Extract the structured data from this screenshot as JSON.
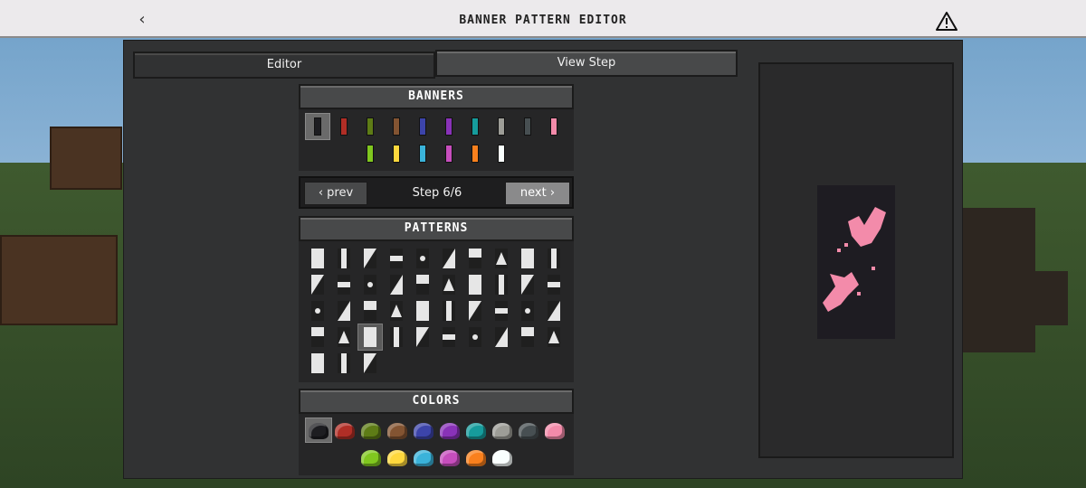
{
  "header": {
    "title": "BANNER PATTERN EDITOR",
    "back_glyph": "‹",
    "warning_icon": "warning-triangle-icon"
  },
  "tabs": [
    {
      "label": "Editor",
      "active": false
    },
    {
      "label": "View Step",
      "active": true
    }
  ],
  "sections": {
    "banners": "BANNERS",
    "patterns": "PATTERNS",
    "colors": "COLORS"
  },
  "stepper": {
    "prev_label": "‹ prev",
    "step_label": "Step 6/6",
    "next_label": "next ›"
  },
  "banner_colors": [
    "#1d1d21",
    "#b02e26",
    "#5e7c16",
    "#835432",
    "#3c44aa",
    "#8932b8",
    "#169c9c",
    "#9d9d97",
    "#474f52",
    "#f38baa",
    "#80c71f",
    "#fed83d",
    "#3ab3da",
    "#c74ebd",
    "#f9801d",
    "#f9fffe"
  ],
  "dye_colors": [
    "#1d1d21",
    "#b02e26",
    "#5e7c16",
    "#835432",
    "#3c44aa",
    "#8932b8",
    "#169c9c",
    "#9d9d97",
    "#474f52",
    "#f38baa",
    "#80c71f",
    "#fed83d",
    "#3ab3da",
    "#c74ebd",
    "#f9801d",
    "#f9fffe"
  ],
  "pattern_count": 43,
  "selected_pattern_index": 32,
  "preview": {
    "banner_base": "#1e1c22",
    "pattern_color": "#f38baa"
  }
}
